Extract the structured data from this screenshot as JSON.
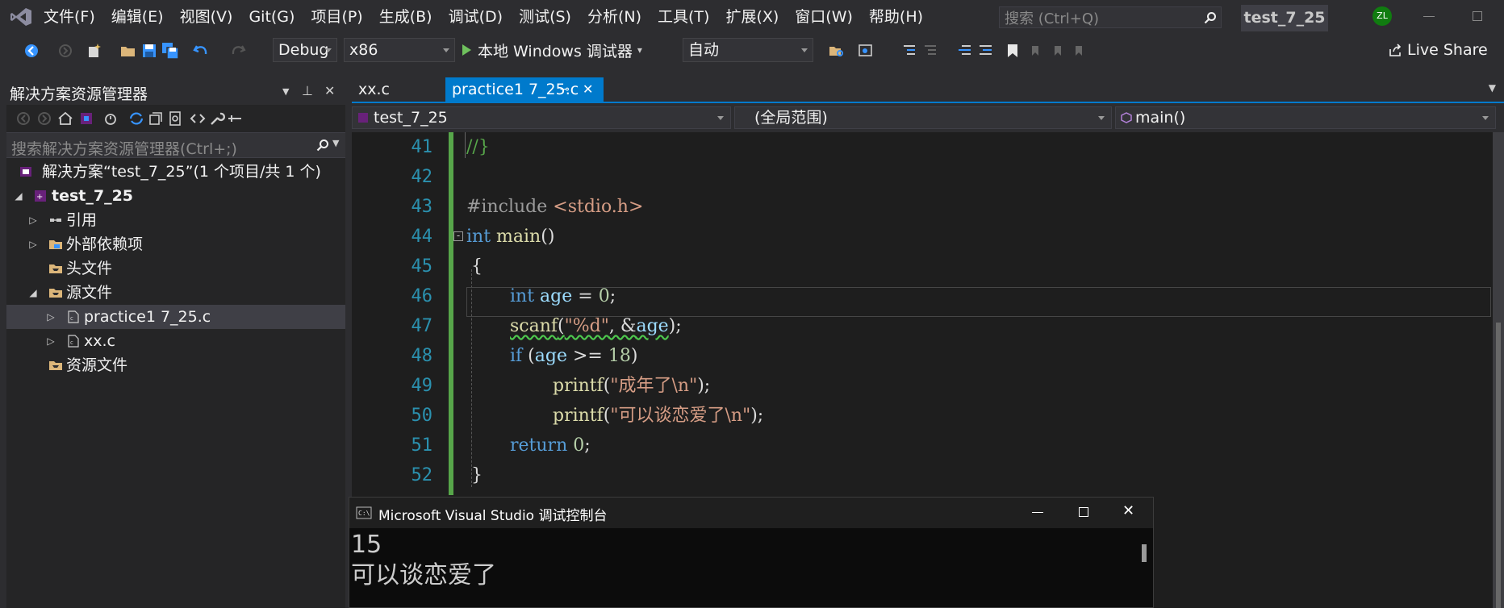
{
  "menubar": {
    "items": [
      "文件(F)",
      "编辑(E)",
      "视图(V)",
      "Git(G)",
      "项目(P)",
      "生成(B)",
      "调试(D)",
      "测试(S)",
      "分析(N)",
      "工具(T)",
      "扩展(X)",
      "窗口(W)",
      "帮助(H)"
    ],
    "search_placeholder": "搜索 (Ctrl+Q)",
    "solution_name": "test_7_25",
    "user_initials": "ZL"
  },
  "toolbar": {
    "config": "Debug",
    "platform": "x86",
    "run_label": "本地 Windows 调试器",
    "run_dropdown": "▾",
    "mode": "自动",
    "live_share": "Live Share"
  },
  "solution_explorer": {
    "title": "解决方案资源管理器",
    "search_placeholder": "搜索解决方案资源管理器(Ctrl+;)",
    "items": [
      {
        "label": "解决方案“test_7_25”(1 个项目/共 1 个)",
        "expander": "",
        "bold": false
      },
      {
        "label": "test_7_25",
        "expander": "◢",
        "bold": true
      },
      {
        "label": "引用",
        "expander": "▷",
        "bold": false
      },
      {
        "label": "外部依赖项",
        "expander": "▷",
        "bold": false
      },
      {
        "label": "头文件",
        "expander": "",
        "bold": false
      },
      {
        "label": "源文件",
        "expander": "◢",
        "bold": false
      },
      {
        "label": "practice1 7_25.c",
        "expander": "▷",
        "bold": false
      },
      {
        "label": "xx.c",
        "expander": "▷",
        "bold": false
      },
      {
        "label": "资源文件",
        "expander": "",
        "bold": false
      }
    ]
  },
  "editor": {
    "tabs": [
      {
        "label": "xx.c",
        "active": false
      },
      {
        "label": "practice1 7_25.c",
        "active": true
      }
    ],
    "pin_glyph": "⊸",
    "close_glyph": "✕",
    "nav": {
      "project": "test_7_25",
      "scope": "(全局范围)",
      "member": "main()"
    },
    "line_numbers": [
      "41",
      "42",
      "43",
      "44",
      "45",
      "46",
      "47",
      "48",
      "49",
      "50",
      "51",
      "52"
    ],
    "code": {
      "l41": "//}",
      "l43_pre": "#include ",
      "l43_inc": "<stdio.h>",
      "l44_kw": "int",
      "l44_fn": " main",
      "l44_rest": "()",
      "l45": "{",
      "l46_kw": "int",
      "l46_var": " age",
      "l46_op": " = ",
      "l46_num": "0",
      "l46_end": ";",
      "l47_fn": "scanf",
      "l47_p1": "(",
      "l47_str": "\"%d\"",
      "l47_p2": ", &",
      "l47_var": "age",
      "l47_end": ");",
      "l48_kw": "if",
      "l48_p1": " (",
      "l48_var": "age",
      "l48_op": " >= ",
      "l48_num": "18",
      "l48_end": ")",
      "l49_fn": "printf",
      "l49_p1": "(",
      "l49_str": "\"成年了\\n\"",
      "l49_end": ");",
      "l50_fn": "printf",
      "l50_p1": "(",
      "l50_str": "\"可以谈恋爱了\\n\"",
      "l50_end": ");",
      "l51_kw": "return",
      "l51_sp": " ",
      "l51_num": "0",
      "l51_end": ";",
      "l52": "}"
    }
  },
  "console": {
    "title": "Microsoft Visual Studio 调试控制台",
    "output": "15\n可以谈恋爱了"
  }
}
